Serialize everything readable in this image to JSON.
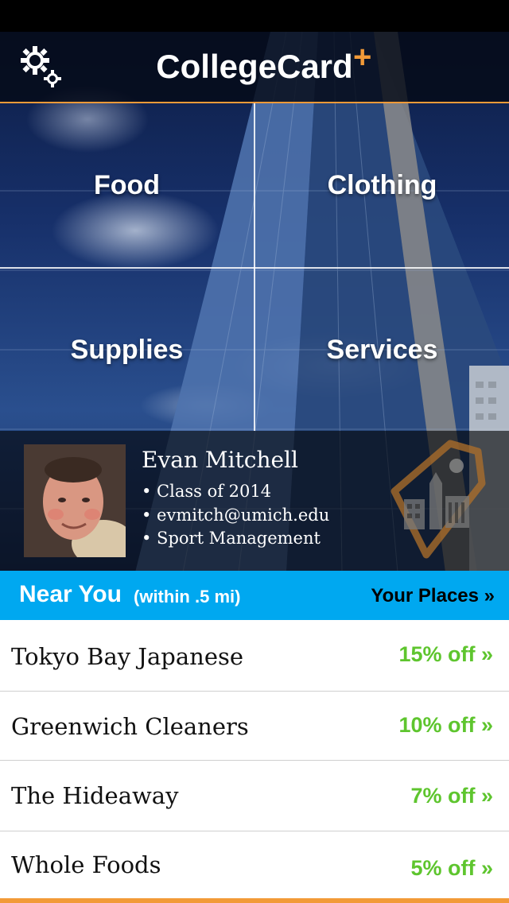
{
  "app": {
    "title": "CollegeCard",
    "title_plus": "+",
    "settings_icon": "gear-icon",
    "accent_color": "#f29a38"
  },
  "categories": [
    {
      "label": "Food"
    },
    {
      "label": "Clothing"
    },
    {
      "label": "Supplies"
    },
    {
      "label": "Services"
    }
  ],
  "profile": {
    "name": "Evan Mitchell",
    "lines": [
      "• Class of 2014",
      "• evmitch@umich.edu",
      "• Sport Management"
    ],
    "badge_icon": "tag-building-icon"
  },
  "near": {
    "title": "Near You",
    "subtitle": "(within .5 mi)",
    "your_places": "Your Places »",
    "bar_color": "#00a8f0"
  },
  "places": [
    {
      "name": "Tokyo Bay Japanese",
      "discount": "15% off »"
    },
    {
      "name": "Greenwich Cleaners",
      "discount": "10% off »"
    },
    {
      "name": "The Hideaway",
      "discount": "7% off »"
    },
    {
      "name": "Whole Foods",
      "discount": "5% off »"
    }
  ],
  "discount_color": "#5ec52e"
}
